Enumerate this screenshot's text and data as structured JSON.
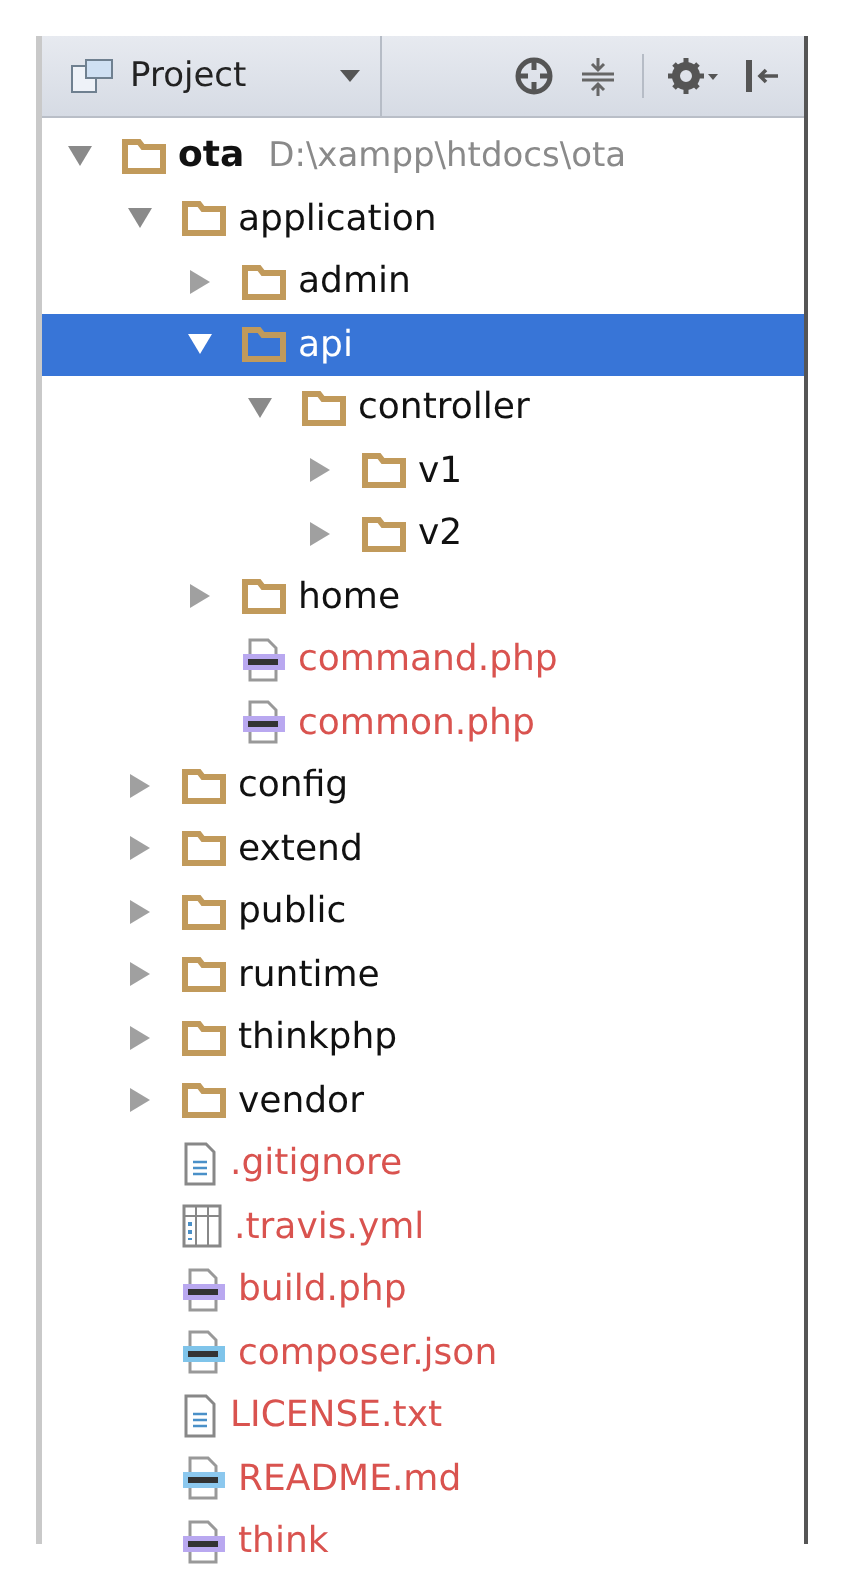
{
  "toolbar": {
    "view_title": "Project"
  },
  "tree": [
    {
      "kind": "folder",
      "name": "ota",
      "path": "D:\\xampp\\htdocs\\ota",
      "expanded": true,
      "selected": false,
      "children": [
        {
          "kind": "folder",
          "name": "application",
          "expanded": true,
          "selected": false,
          "children": [
            {
              "kind": "folder",
              "name": "admin",
              "expanded": false,
              "selected": false
            },
            {
              "kind": "folder",
              "name": "api",
              "expanded": true,
              "selected": true,
              "children": [
                {
                  "kind": "folder",
                  "name": "controller",
                  "expanded": true,
                  "selected": false,
                  "children": [
                    {
                      "kind": "folder",
                      "name": "v1",
                      "expanded": false,
                      "selected": false
                    },
                    {
                      "kind": "folder",
                      "name": "v2",
                      "expanded": false,
                      "selected": false
                    }
                  ]
                }
              ]
            },
            {
              "kind": "folder",
              "name": "home",
              "expanded": false,
              "selected": false
            },
            {
              "kind": "php",
              "name": "command.php",
              "selected": false
            },
            {
              "kind": "php",
              "name": "common.php",
              "selected": false
            }
          ]
        },
        {
          "kind": "folder",
          "name": "config",
          "expanded": false,
          "selected": false
        },
        {
          "kind": "folder",
          "name": "extend",
          "expanded": false,
          "selected": false
        },
        {
          "kind": "folder",
          "name": "public",
          "expanded": false,
          "selected": false
        },
        {
          "kind": "folder",
          "name": "runtime",
          "expanded": false,
          "selected": false
        },
        {
          "kind": "folder",
          "name": "thinkphp",
          "expanded": false,
          "selected": false
        },
        {
          "kind": "folder",
          "name": "vendor",
          "expanded": false,
          "selected": false
        },
        {
          "kind": "text",
          "name": ".gitignore",
          "selected": false
        },
        {
          "kind": "table",
          "name": ".travis.yml",
          "selected": false
        },
        {
          "kind": "php",
          "name": "build.php",
          "selected": false
        },
        {
          "kind": "json",
          "name": "composer.json",
          "selected": false
        },
        {
          "kind": "text",
          "name": "LICENSE.txt",
          "selected": false
        },
        {
          "kind": "md",
          "name": "README.md",
          "selected": false
        },
        {
          "kind": "php",
          "name": "think",
          "selected": false
        }
      ]
    }
  ]
}
